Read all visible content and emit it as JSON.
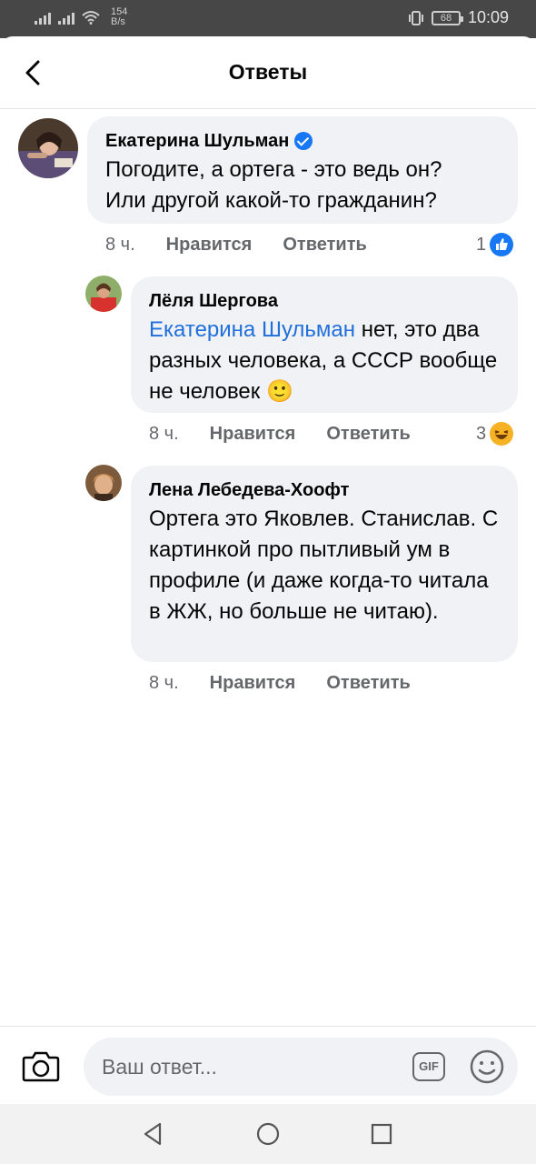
{
  "status_bar": {
    "speed_value": "154",
    "speed_unit": "B/s",
    "battery": "68",
    "time": "10:09"
  },
  "header": {
    "title": "Ответы",
    "back_icon": "chevron-left-icon"
  },
  "comments": [
    {
      "author": "Екатерина Шульман",
      "verified": true,
      "text_lines": [
        "Погодите, а ортега - это ведь он?",
        "Или другой какой-то гражданин?"
      ],
      "time": "8 ч.",
      "like_label": "Нравится",
      "reply_label": "Ответить",
      "reaction_count": "1",
      "reaction_icon": "like-icon"
    },
    {
      "author": "Лёля Шергова",
      "mention": "Екатерина Шульман",
      "text_after_mention": " нет, это два разных человека, а СССР вообще не человек",
      "emoji": "🙂",
      "time": "8 ч.",
      "like_label": "Нравится",
      "reply_label": "Ответить",
      "reaction_count": "3",
      "reaction_icon": "laugh-icon"
    },
    {
      "author": "Лена Лебедева-Хоофт",
      "text": "Ортега это Яковлев. Станислав. С картинкой про пытливый ум в профиле (и даже когда-то читала в ЖЖ, но больше не читаю).",
      "time": "8 ч.",
      "like_label": "Нравится",
      "reply_label": "Ответить"
    }
  ],
  "composer": {
    "placeholder": "Ваш ответ...",
    "gif_label": "GIF"
  },
  "colors": {
    "accent": "#1877f2",
    "mention": "#216fdb",
    "bubble": "#f0f2f5",
    "muted_text": "#65676b"
  }
}
